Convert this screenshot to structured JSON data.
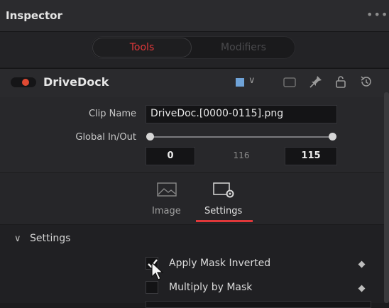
{
  "header": {
    "title": "Inspector",
    "more_glyph": "•••"
  },
  "tabs": [
    {
      "label": "Tools",
      "active": true
    },
    {
      "label": "Modifiers",
      "active": false
    }
  ],
  "node": {
    "name": "DriveDock",
    "enabled": true,
    "color_swatch": "#6fa3d8",
    "icons": [
      "node-version-icon",
      "pin-icon",
      "lock-icon",
      "reset-icon"
    ]
  },
  "fields": {
    "clip_name_label": "Clip Name",
    "clip_name_value": "DriveDoc.[0000-0115].png",
    "global_label": "Global In/Out",
    "global_in": "0",
    "global_mid": "116",
    "global_out": "115"
  },
  "subtabs": [
    {
      "label": "Image",
      "icon": "image-icon",
      "active": false
    },
    {
      "label": "Settings",
      "icon": "settings-icon",
      "active": true
    }
  ],
  "settings_section": {
    "title": "Settings",
    "checkboxes": [
      {
        "label": "Apply Mask Inverted",
        "checked": true
      },
      {
        "label": "Multiply by Mask",
        "checked": false
      }
    ]
  },
  "colors": {
    "accent": "#e0383a",
    "background": "#28282b"
  }
}
